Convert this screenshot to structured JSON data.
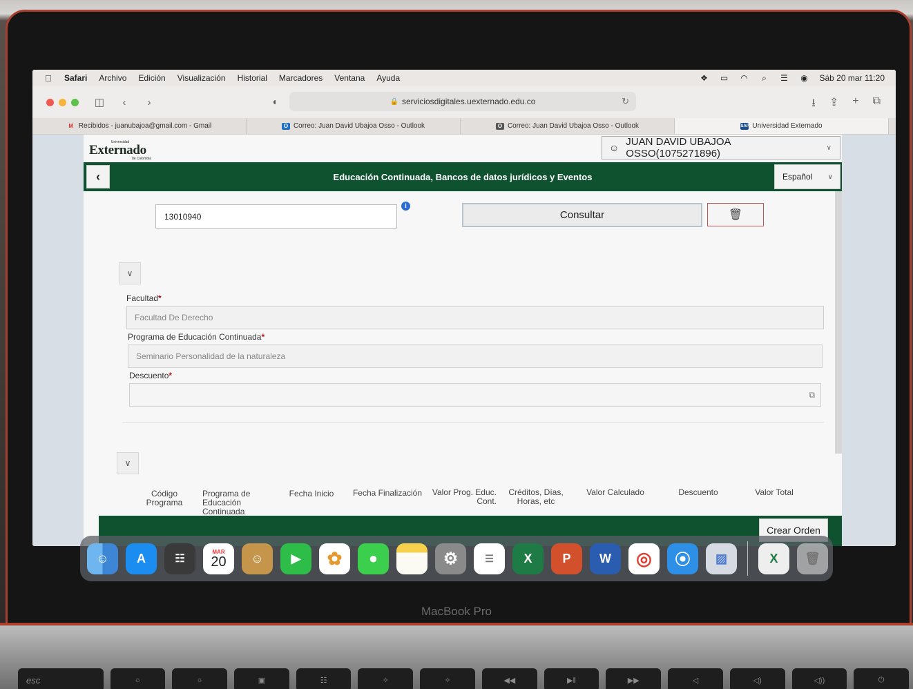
{
  "menubar": {
    "items": [
      "Safari",
      "Archivo",
      "Edición",
      "Visualización",
      "Historial",
      "Marcadores",
      "Ventana",
      "Ayuda"
    ],
    "clock": "Sáb 20 mar  11:20"
  },
  "browser": {
    "url": "serviciosdigitales.uexternado.edu.co",
    "tabs": [
      {
        "label": "Recibidos - juanubajoa@gmail.com - Gmail",
        "icon": "gmail-icon"
      },
      {
        "label": "Correo: Juan David Ubajoa Osso - Outlook",
        "icon": "outlook-icon"
      },
      {
        "label": "Correo: Juan David Ubajoa Osso - Outlook",
        "icon": "outlook-icon"
      },
      {
        "label": "Universidad Externado",
        "icon": "sap-icon"
      }
    ]
  },
  "app": {
    "logo_small": "Universidad",
    "logo_main": "Externado",
    "logo_sub": "de Colombia",
    "user": "JUAN DAVID UBAJOA OSSO(1075271896)",
    "title": "Educación Continuada, Bancos de datos jurídicos y Eventos",
    "language": "Español",
    "search_value": "13010940",
    "consultar_label": "Consultar",
    "facultad_label": "Facultad",
    "facultad_value": "Facultad De Derecho",
    "programa_label": "Programa de Educación Continuada",
    "programa_value": "Seminario Personalidad de la naturaleza",
    "descuento_label": "Descuento",
    "descuento_value": "",
    "required_mark": "*",
    "columns": [
      "Código Programa",
      "Programa de Educación Continuada",
      "Fecha Inicio",
      "Fecha Finalización",
      "Valor Prog. Educ. Cont.",
      "Créditos, Días, Horas, etc",
      "Valor Calculado",
      "Descuento",
      "Valor Total"
    ],
    "crear_label": "Crear Orden"
  },
  "dock": {
    "apps": [
      "finder-icon",
      "app-store-icon",
      "calculator-icon",
      "calendar-icon",
      "contacts-icon",
      "facetime-icon",
      "photos-icon",
      "messages-icon",
      "notes-icon",
      "system-preferences-icon",
      "reminders-icon",
      "excel-icon",
      "powerpoint-icon",
      "word-icon",
      "chrome-icon",
      "safari-icon",
      "preview-icon",
      "excel-file-icon",
      "trash-icon"
    ],
    "calendar_month": "MAR",
    "calendar_day": "20"
  },
  "device": {
    "label": "MacBook Pro",
    "esc_key": "esc"
  },
  "colors": {
    "brand_green": "#0e5230",
    "required_red": "#b0161d"
  }
}
